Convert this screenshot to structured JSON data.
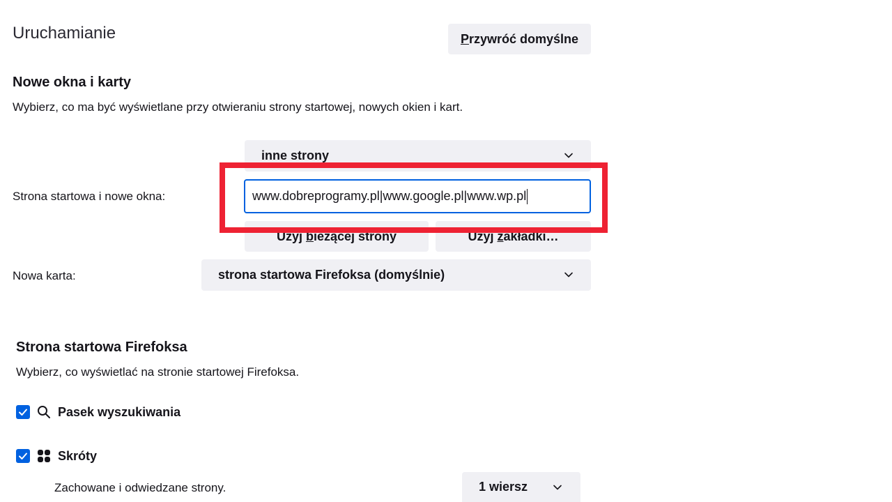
{
  "startup": {
    "title": "Uruchamianie",
    "restore_defaults": {
      "key": "P",
      "rest": "rzywróć domyślne"
    }
  },
  "new_windows": {
    "heading": "Nowe okna i karty",
    "description": "Wybierz, co ma być wyświetlane przy otwieraniu strony startowej, nowych okien i kart.",
    "homepage_label": "Strona startowa i nowe okna:",
    "homepage_select": "inne strony",
    "homepage_urls": "www.dobreprogramy.pl|www.google.pl|www.wp.pl",
    "use_current_btn": {
      "pre": "Użyj ",
      "key": "b",
      "rest": "ieżącej strony"
    },
    "use_bookmark_btn": {
      "pre": "Użyj ",
      "key": "z",
      "rest": "akładki…"
    },
    "new_tab_label": "Nowa karta:",
    "new_tab_select": "strona startowa Firefoksa (domyślnie)"
  },
  "firefox_home": {
    "heading": "Strona startowa Firefoksa",
    "description": "Wybierz, co wyświetlać na stronie startowej Firefoksa.",
    "search_bar": {
      "label": "Pasek wyszukiwania",
      "checked": true,
      "icon": "search-icon"
    },
    "shortcuts": {
      "label": "Skróty",
      "checked": true,
      "icon": "grid-icon"
    },
    "shortcuts_sub": "Zachowane i odwiedzane strony.",
    "rows_select": "1 wiersz"
  },
  "colors": {
    "accent": "#0061e0",
    "highlight_frame": "#ee2233",
    "button_bg": "#f0f0f4"
  }
}
